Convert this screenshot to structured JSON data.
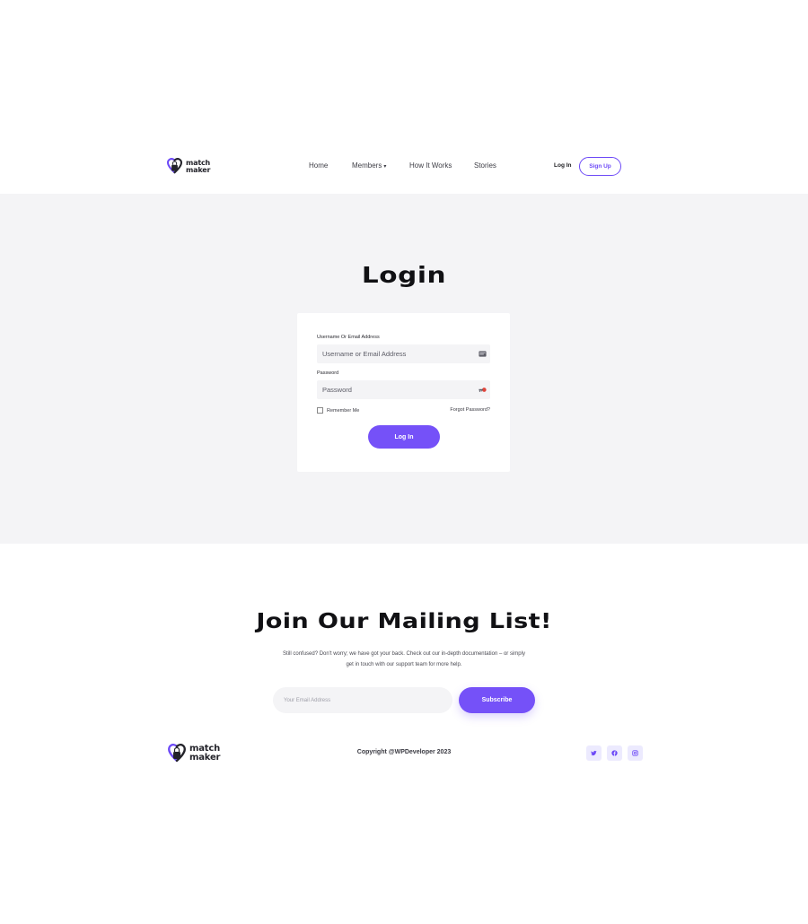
{
  "header": {
    "logo": {
      "line1": "match",
      "line2": "maker"
    },
    "nav": [
      {
        "label": "Home"
      },
      {
        "label": "Members"
      },
      {
        "label": "How It Works"
      },
      {
        "label": "Stories"
      }
    ],
    "login_label": "Log In",
    "signup_label": "Sign Up"
  },
  "login": {
    "title": "Login",
    "username_label": "Username Or Email Address",
    "username_placeholder": "Username or Email Address",
    "password_label": "Password",
    "password_placeholder": "Password",
    "remember_label": "Remember Me",
    "remember_checked": false,
    "forgot_label": "Forgot Password?",
    "submit_label": "Log In"
  },
  "mailing": {
    "title": "Join Our Mailing List!",
    "description_line1": "Still confused? Don't worry; we have got your back. Check out our in-depth documentation – or simply",
    "description_line2": "get in touch with our support team for more help.",
    "email_placeholder": "Your Email Address",
    "subscribe_label": "Subscribe"
  },
  "footer": {
    "logo": {
      "line1": "match",
      "line2": "maker"
    },
    "copyright": "Copyright @WPDeveloper 2023",
    "socials": [
      {
        "icon": "twitter-icon"
      },
      {
        "icon": "facebook-icon"
      },
      {
        "icon": "instagram-icon"
      }
    ]
  },
  "colors": {
    "accent": "#7551f8",
    "section_bg": "#f4f4f6",
    "social_bg": "#eceafe"
  }
}
